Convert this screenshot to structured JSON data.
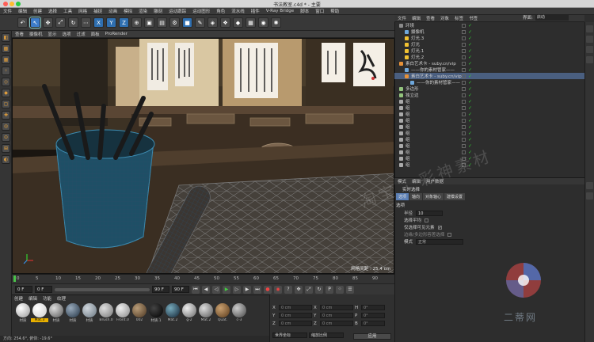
{
  "window": {
    "title": "书法教室.c4d * - 主要"
  },
  "menubar": [
    "文件",
    "编辑",
    "创建",
    "选择",
    "工具",
    "网格",
    "捕捉",
    "动画",
    "模拟",
    "渲染",
    "雕刻",
    "运动跟踪",
    "运动图形",
    "角色",
    "流水线",
    "插件",
    "V-Ray Bridge",
    "脚本",
    "窗口",
    "帮助"
  ],
  "viewport": {
    "menu": [
      "查看",
      "摄像机",
      "显示",
      "选项",
      "过滤",
      "面板",
      "ProRender"
    ],
    "info": "网格间距 : 25.4 cm"
  },
  "timeline": {
    "ticks": [
      "0",
      "5",
      "10",
      "15",
      "20",
      "25",
      "30",
      "35",
      "40",
      "45",
      "50",
      "55",
      "60",
      "65",
      "70",
      "75",
      "80",
      "85",
      "90"
    ],
    "start_field": "0 F",
    "current_field": "0 F",
    "end_field": "90 F",
    "end_field2": "90 F",
    "right_field": "0 F"
  },
  "materials": {
    "menu": [
      "创建",
      "编辑",
      "功能",
      "纹理"
    ],
    "items": [
      "材质",
      "Mat.3",
      "材质",
      "材质",
      "材质",
      "Brush.0",
      "Front.0",
      "002",
      "材质.1",
      "Mat.2",
      "g-2",
      "Mat.2",
      "Quat.",
      "c-3"
    ]
  },
  "status": "方向: 254.6°, 俯仰: -19.6°",
  "coords": {
    "rows": [
      {
        "a": "X",
        "av": "0 cm",
        "b": "X",
        "bv": "0 cm",
        "c": "H",
        "cv": "0°"
      },
      {
        "a": "Y",
        "av": "0 cm",
        "b": "Y",
        "bv": "0 cm",
        "c": "P",
        "cv": "0°"
      },
      {
        "a": "Z",
        "av": "0 cm",
        "b": "Z",
        "bv": "0 cm",
        "c": "B",
        "cv": "0°"
      }
    ],
    "mode_left": "世界坐标",
    "mode_mid": "缩放比例",
    "apply": "应用"
  },
  "objmanager": {
    "menu": [
      "文件",
      "编辑",
      "查看",
      "对象",
      "标签",
      "书签"
    ],
    "layout_label": "界面:",
    "layout_value": "启动",
    "objects": [
      {
        "name": "环境",
        "indent": 0
      },
      {
        "name": "摄像机",
        "indent": 1
      },
      {
        "name": "灯光.3",
        "indent": 1
      },
      {
        "name": "灯光",
        "indent": 1
      },
      {
        "name": "灯光.1",
        "indent": 1
      },
      {
        "name": "灯光.2",
        "indent": 1
      },
      {
        "name": "素白艺术卡 - suby.cn/vip",
        "indent": 0
      },
      {
        "name": "——你的素材管家——",
        "indent": 1
      },
      {
        "name": "素白艺术卡 - suby.cn/vip",
        "indent": 1
      },
      {
        "name": "——你的素材管家——",
        "indent": 2
      },
      {
        "name": "多边形",
        "indent": 0
      },
      {
        "name": "独立边",
        "indent": 0
      },
      {
        "name": "组",
        "indent": 0
      },
      {
        "name": "组",
        "indent": 0
      },
      {
        "name": "组",
        "indent": 0
      },
      {
        "name": "组",
        "indent": 0
      },
      {
        "name": "组",
        "indent": 0
      },
      {
        "name": "组",
        "indent": 0
      },
      {
        "name": "组",
        "indent": 0
      },
      {
        "name": "组",
        "indent": 0
      },
      {
        "name": "组",
        "indent": 0
      },
      {
        "name": "组",
        "indent": 0
      },
      {
        "name": "组",
        "indent": 0
      }
    ]
  },
  "attributes": {
    "menu": [
      "模式",
      "编辑",
      "用户数据"
    ],
    "title": "实时选择",
    "tabs": [
      "选项",
      "轴向",
      "对象轴心",
      "建模设置"
    ],
    "section": "选项",
    "radius_label": "半径",
    "radius_value": "10",
    "row2": "选择平均",
    "row3": "仅选择可见元素",
    "row4": "边缘/多边形容差选择",
    "mode_label": "模式",
    "mode_value": "正常"
  },
  "watermark": "淘宝 · 彩神素材",
  "logo_text": "二蒂网",
  "colors": {
    "accent": "#3d7cc9",
    "highlight": "#4a5f80",
    "viewport_bg": "#1a1510"
  }
}
